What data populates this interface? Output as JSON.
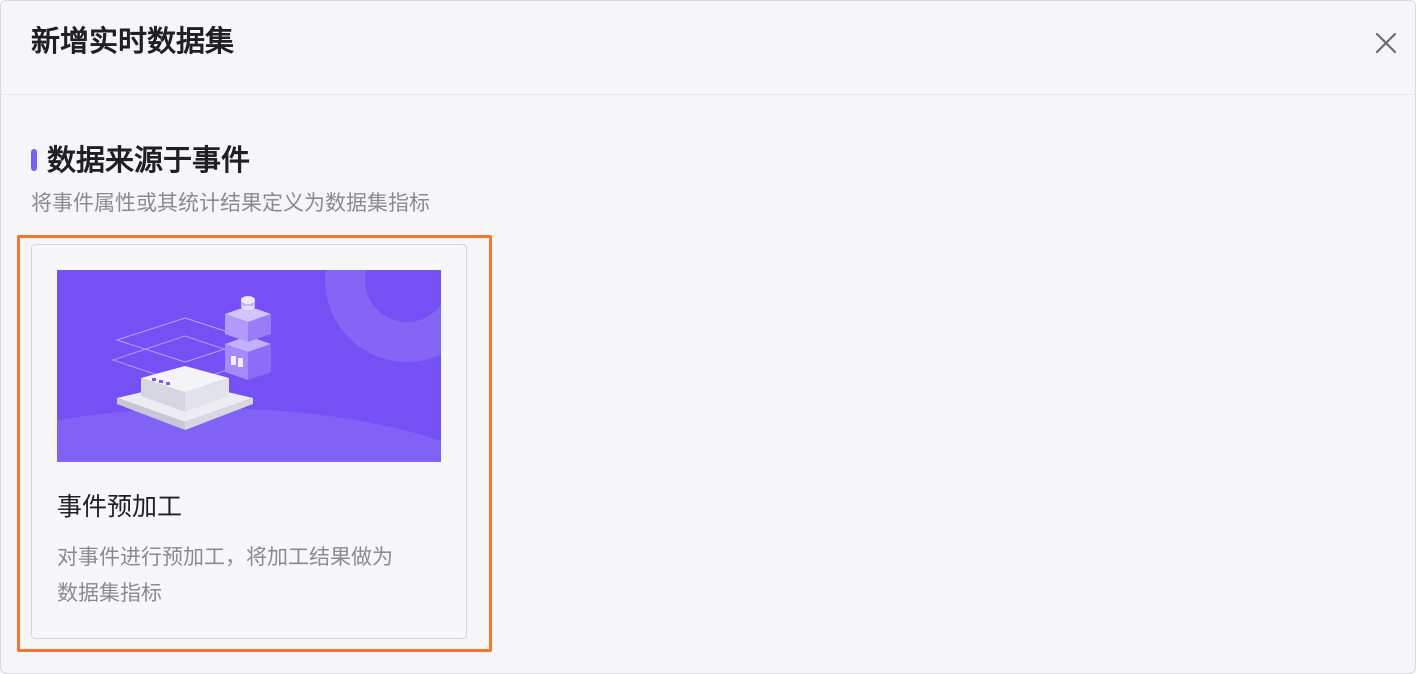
{
  "dialog": {
    "title": "新增实时数据集",
    "close_icon": "close-icon"
  },
  "section": {
    "title": "数据来源于事件",
    "description": "将事件属性或其统计结果定义为数据集指标",
    "accent_color": "#7b5cf5"
  },
  "cards": [
    {
      "title": "事件预加工",
      "description_line1": "对事件进行预加工，将加工结果做为",
      "description_line2": "数据集指标",
      "illustration": "event-preprocessing-illustration",
      "banner_color": "#7550f4"
    }
  ],
  "highlight_color": "#f0782f"
}
